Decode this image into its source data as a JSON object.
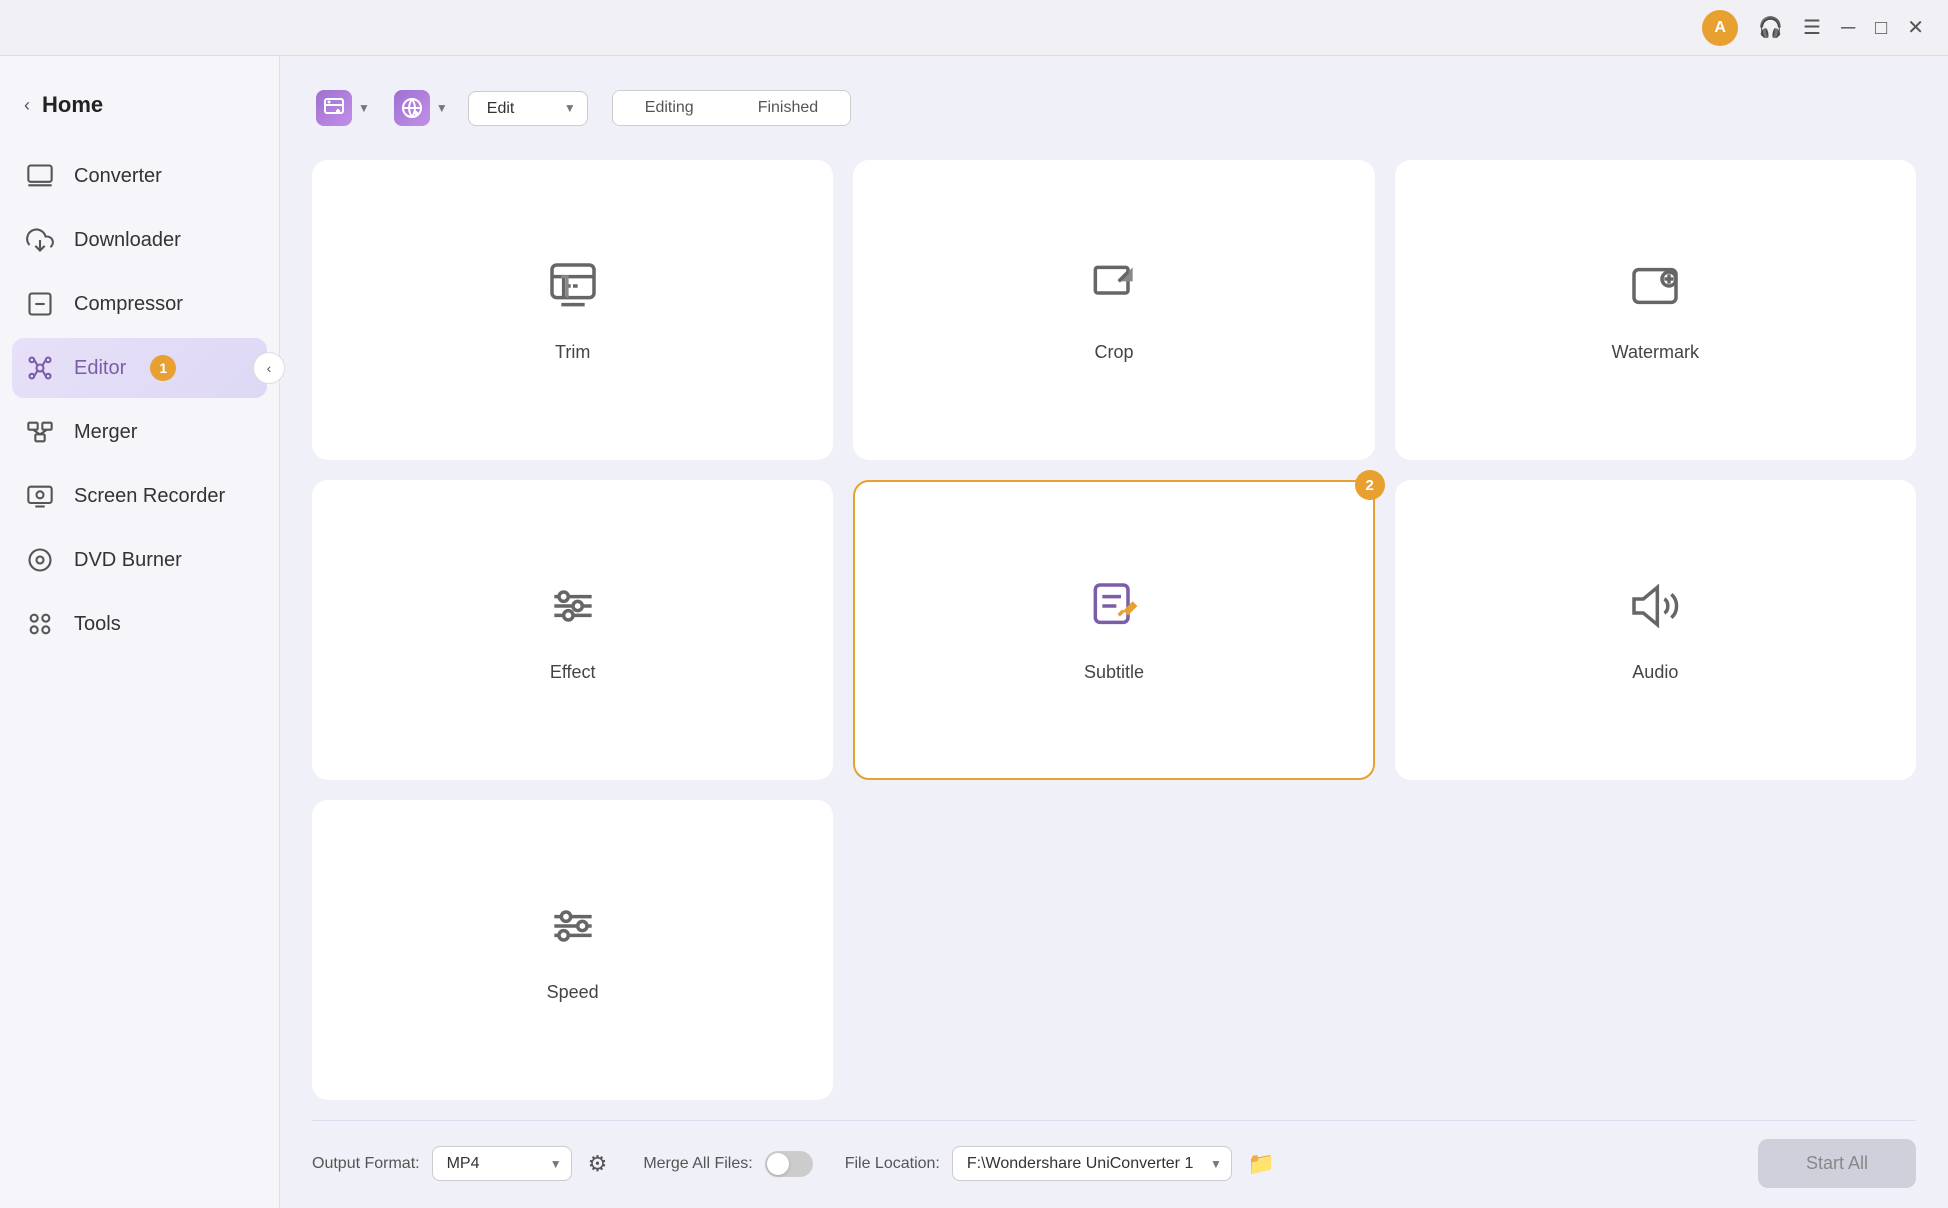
{
  "titlebar": {
    "user_initial": "A",
    "icons": [
      "headset-icon",
      "menu-icon",
      "minimize-icon",
      "maximize-icon",
      "close-icon"
    ]
  },
  "sidebar": {
    "header": {
      "back_arrow": "‹",
      "title": "Home"
    },
    "items": [
      {
        "id": "converter",
        "label": "Converter",
        "icon": "converter-icon"
      },
      {
        "id": "downloader",
        "label": "Downloader",
        "icon": "downloader-icon"
      },
      {
        "id": "compressor",
        "label": "Compressor",
        "icon": "compressor-icon"
      },
      {
        "id": "editor",
        "label": "Editor",
        "icon": "editor-icon",
        "badge": "1",
        "active": true
      },
      {
        "id": "merger",
        "label": "Merger",
        "icon": "merger-icon"
      },
      {
        "id": "screen-recorder",
        "label": "Screen Recorder",
        "icon": "screen-recorder-icon"
      },
      {
        "id": "dvd-burner",
        "label": "DVD Burner",
        "icon": "dvd-burner-icon"
      },
      {
        "id": "tools",
        "label": "Tools",
        "icon": "tools-icon"
      }
    ]
  },
  "toolbar": {
    "add_file_btn": "Add Files",
    "add_url_btn": "Add URL",
    "edit_label": "Edit",
    "tabs": {
      "editing": "Editing",
      "finished": "Finished",
      "active": "editing"
    }
  },
  "editor_cards": [
    {
      "id": "trim",
      "label": "Trim",
      "icon": "trim-icon",
      "highlighted": false,
      "badge": null
    },
    {
      "id": "crop",
      "label": "Crop",
      "icon": "crop-icon",
      "highlighted": false,
      "badge": null
    },
    {
      "id": "watermark",
      "label": "Watermark",
      "icon": "watermark-icon",
      "highlighted": false,
      "badge": null
    },
    {
      "id": "effect",
      "label": "Effect",
      "icon": "effect-icon",
      "highlighted": false,
      "badge": null
    },
    {
      "id": "subtitle",
      "label": "Subtitle",
      "icon": "subtitle-icon",
      "highlighted": true,
      "badge": "2"
    },
    {
      "id": "audio",
      "label": "Audio",
      "icon": "audio-icon",
      "highlighted": false,
      "badge": null
    },
    {
      "id": "speed",
      "label": "Speed",
      "icon": "speed-icon",
      "highlighted": false,
      "badge": null
    }
  ],
  "bottom_bar": {
    "output_format_label": "Output Format:",
    "output_format_value": "MP4",
    "file_location_label": "File Location:",
    "file_location_value": "F:\\Wondershare UniConverter 1",
    "merge_label": "Merge All Files:",
    "start_all_label": "Start All"
  }
}
